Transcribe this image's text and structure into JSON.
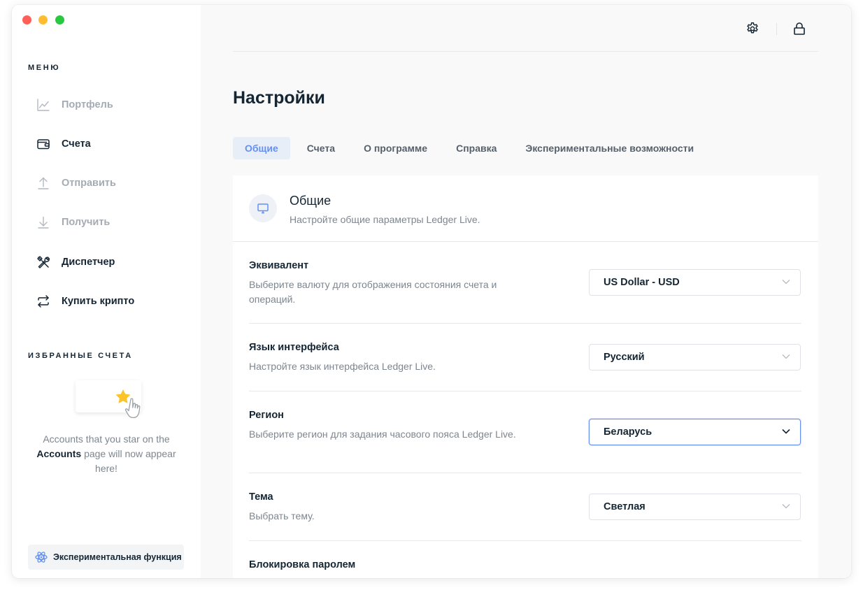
{
  "sidebar": {
    "menu_title": "МЕНЮ",
    "items": [
      {
        "label": "Портфель",
        "icon": "chart-icon",
        "state": "disabled"
      },
      {
        "label": "Счета",
        "icon": "wallet-icon",
        "state": "enabled"
      },
      {
        "label": "Отправить",
        "icon": "arrow-up-icon",
        "state": "disabled"
      },
      {
        "label": "Получить",
        "icon": "arrow-down-icon",
        "state": "disabled"
      },
      {
        "label": "Диспетчер",
        "icon": "tools-icon",
        "state": "enabled"
      },
      {
        "label": "Купить крипто",
        "icon": "swap-icon",
        "state": "enabled"
      }
    ],
    "favorites_title": "ИЗБРАННЫЕ СЧЕТА",
    "favorites_empty": {
      "before": "Accounts that you star on the",
      "bold": "Accounts",
      "after": "page will now appear here!"
    },
    "experimental_label": "Экспериментальная функция"
  },
  "topbar": {
    "icons": [
      "gear-icon",
      "lock-icon"
    ]
  },
  "page": {
    "title": "Настройки",
    "tabs": [
      {
        "label": "Общие",
        "active": true
      },
      {
        "label": "Счета",
        "active": false
      },
      {
        "label": "О программе",
        "active": false
      },
      {
        "label": "Справка",
        "active": false
      },
      {
        "label": "Экспериментальные возможности",
        "active": false
      }
    ]
  },
  "general": {
    "title": "Общие",
    "subtitle": "Настройте общие параметры Ledger Live.",
    "rows": [
      {
        "title": "Эквивалент",
        "desc": "Выберите валюту для отображения состояния счета и операций.",
        "value": "US Dollar - USD"
      },
      {
        "title": "Язык интерфейса",
        "desc": "Настройте язык интерфейса Ledger Live.",
        "value": "Русский"
      },
      {
        "title": "Регион",
        "desc": "Выберите регион для задания часового пояса Ledger Live.",
        "value": "Беларусь"
      },
      {
        "title": "Тема",
        "desc": "Выбрать тему.",
        "value": "Светлая"
      },
      {
        "title": "Блокировка паролем"
      }
    ]
  },
  "colors": {
    "accent": "#6490f1",
    "text": "#142533",
    "muted": "#7d868f",
    "star": "#fcc42a"
  }
}
